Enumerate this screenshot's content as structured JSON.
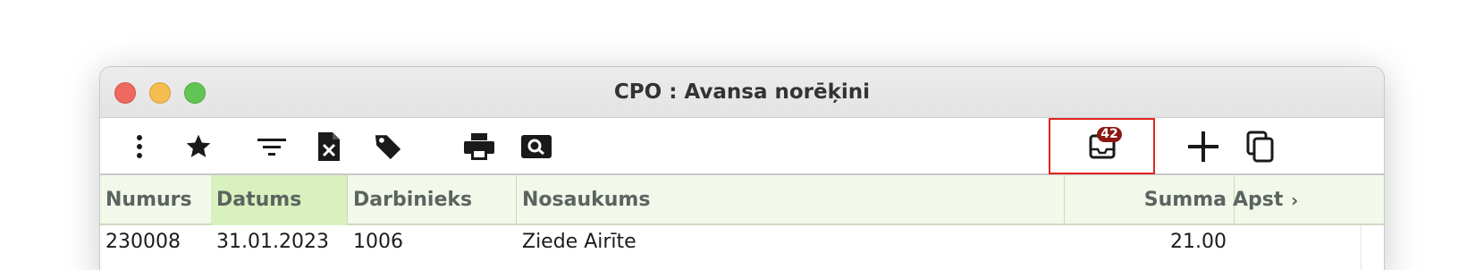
{
  "window": {
    "title": "CPO : Avansa norēķini"
  },
  "toolbar": {
    "icons": [
      "more-vertical-icon",
      "star-icon",
      "filter-icon",
      "excel-file-icon",
      "tag-icon",
      "printer-icon",
      "search-preview-icon",
      "inbox-icon",
      "plus-icon",
      "copy-icon"
    ],
    "inbox_badge": "42",
    "accent_color": "#e0261f"
  },
  "table": {
    "columns": [
      "Numurs",
      "Datums",
      "Darbinieks",
      "Nosaukums",
      "Summa",
      "Apst"
    ],
    "active_column": "Datums",
    "header_bg": "#f2f8ea",
    "active_header_bg": "#d8f1bf",
    "rows": [
      {
        "numurs": "230008",
        "datums": "31.01.2023",
        "darbinieks": "1006",
        "nosaukums": "Ziede Airīte",
        "summa": "21.00",
        "apst": ""
      }
    ]
  }
}
